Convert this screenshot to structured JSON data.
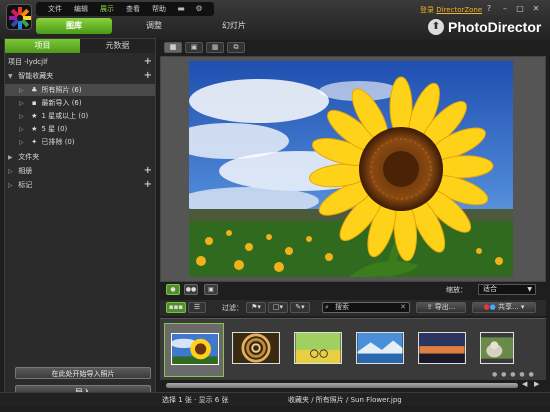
{
  "menubar": {
    "items": [
      "文件",
      "编辑",
      "展示",
      "查看",
      "帮助"
    ],
    "active_index": 2,
    "settings_icon": "gear-icon",
    "minimize_icon": "minimize-icon"
  },
  "modes": {
    "library": "图库",
    "adjust": "调整",
    "slideshow": "幻灯片"
  },
  "account": {
    "login": "登录",
    "zone": "DirectorZone"
  },
  "window": {
    "help": "?",
    "minimize": "–",
    "maximize": "□",
    "close": "✕"
  },
  "brand": {
    "name": "PhotoDirector"
  },
  "left_panel": {
    "tab_project": "项目",
    "tab_metadata": "元数据",
    "project_label": "项目 -lydcjlf",
    "smart_collections": "智能收藏夹",
    "items": [
      {
        "label": "所有照片 (6)",
        "icon": "photos-icon",
        "selected": true
      },
      {
        "label": "最新导入 (6)",
        "icon": "import-icon",
        "selected": false
      },
      {
        "label": "1 星或以上 (0)",
        "icon": "star-icon",
        "selected": false
      },
      {
        "label": "5 星 (0)",
        "icon": "star-icon",
        "selected": false
      },
      {
        "label": "已排除 (0)",
        "icon": "exclude-icon",
        "selected": false
      }
    ],
    "folders": "文件夹",
    "albums": "相册",
    "tags": "标记",
    "import_hint": "在此处开始导入照片",
    "import_button": "导入"
  },
  "viewer": {
    "zoom_label": "缩放：",
    "zoom_value": "适合",
    "filter_label": "过滤：",
    "search_placeholder": "搜索",
    "export_label": "导出...",
    "share_label": "共享..."
  },
  "filmstrip": {
    "thumbnails": [
      "sunflower",
      "spiral-staircase",
      "field-bicycle",
      "lake-mountains",
      "sunset-sky",
      "cat"
    ],
    "selected_index": 0
  },
  "status": {
    "left": "选择 1 张 · 显示 6 张",
    "right": "收藏夹  / 所有照片 / Sun Flower.jpg"
  },
  "colors": {
    "accent": "#6dbb2e",
    "login": "#f0b428",
    "background": "#1e1e1e"
  }
}
